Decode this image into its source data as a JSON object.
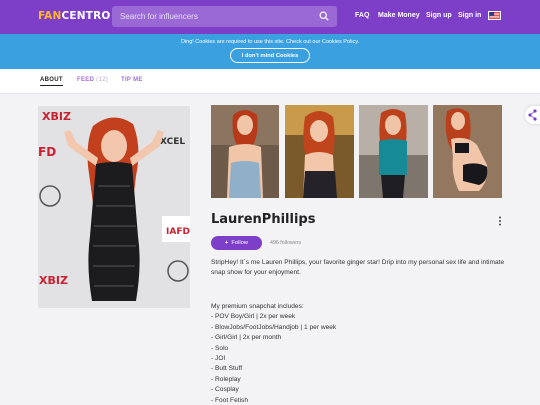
{
  "header": {
    "logo_fan": "FAN",
    "logo_centro": "CENTRO",
    "search_placeholder": "Search for influencers",
    "nav": [
      "FAQ",
      "Make Money",
      "Sign up",
      "Sign in"
    ]
  },
  "cookie_bar": {
    "text": "Ding! Cookies are required to use this site. Check out our Cookies Policy.",
    "button": "I don't mind Cookies"
  },
  "tabs": {
    "about": "ABOUT",
    "feed": "FEED",
    "feed_count": "(12)",
    "tip": "TIP ME"
  },
  "profile": {
    "name": "LaurenPhillips",
    "follow_label": "Follow",
    "followers": "496 followers",
    "bio": "StripHey! It`s me Lauren Phillips, your favorite ginger star! Drip into my personal sex life and intimate snap show for your enjoyment.",
    "list_intro": "My premium snapchat includes:",
    "list": [
      "- POV Boy/Girl | 2x per week",
      "- BlowJobs/FootJobs/Handjob | 1 per week",
      "- Girl/Girl | 2x per month",
      "- Solo",
      "- JOI",
      "- Butt Stuff",
      "- Roleplay",
      "- Cosplay",
      "- Foot Fetish"
    ],
    "photo_logos": {
      "xbiz_top": "XBIZ",
      "fd_left": "FD",
      "xbiz_bottom": "XBIZ",
      "xcel": "XCEL",
      "iafd": "IAFD"
    }
  },
  "colors": {
    "brand_purple": "#7d3fc7",
    "cookie_blue": "#3aa0e0",
    "logo_orange": "#ffb627",
    "tab_purple": "#a36fd9"
  }
}
